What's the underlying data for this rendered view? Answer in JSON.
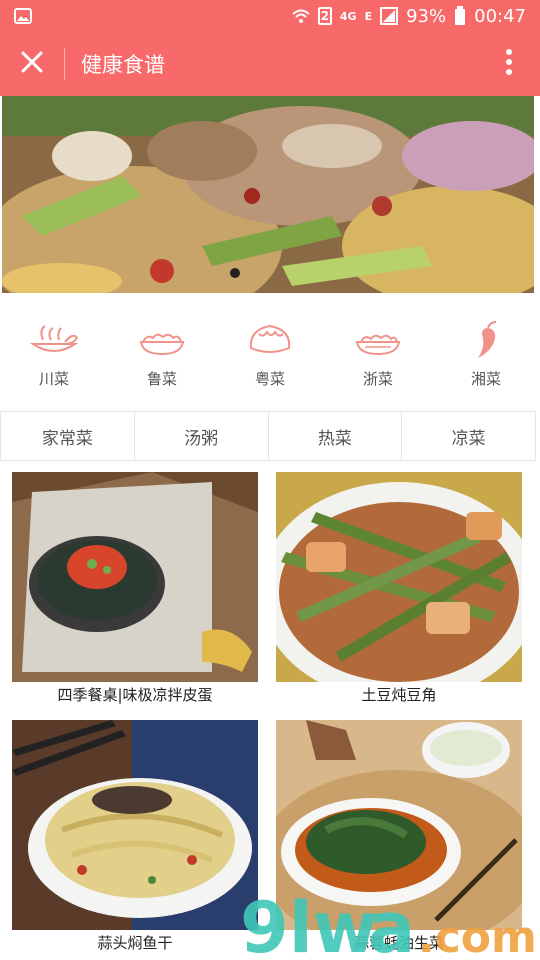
{
  "status_bar": {
    "sim_slot": "2",
    "network": "4G",
    "network2": "E",
    "battery": "93%",
    "time": "00:47",
    "icons": [
      "image-icon",
      "wifi-icon",
      "signal-icon",
      "battery-icon"
    ]
  },
  "app_bar": {
    "title": "健康食谱",
    "close_icon": "close-icon",
    "more_icon": "more-vert-icon",
    "color": "#f86a6a"
  },
  "cuisines": [
    {
      "label": "川菜",
      "icon": "sichuan-dish-icon"
    },
    {
      "label": "鲁菜",
      "icon": "shandong-dish-icon"
    },
    {
      "label": "粤菜",
      "icon": "dumpling-icon"
    },
    {
      "label": "浙菜",
      "icon": "zhejiang-dish-icon"
    },
    {
      "label": "湘菜",
      "icon": "chili-icon"
    }
  ],
  "tabs": [
    {
      "label": "家常菜"
    },
    {
      "label": "汤粥"
    },
    {
      "label": "热菜"
    },
    {
      "label": "凉菜"
    }
  ],
  "recipes": [
    {
      "title": "四季餐桌|味极凉拌皮蛋"
    },
    {
      "title": "土豆炖豆角"
    },
    {
      "title": "蒜头焖鱼干"
    },
    {
      "title": "蒜蓉蚝油生菜"
    }
  ],
  "watermark": "9lwa.com"
}
